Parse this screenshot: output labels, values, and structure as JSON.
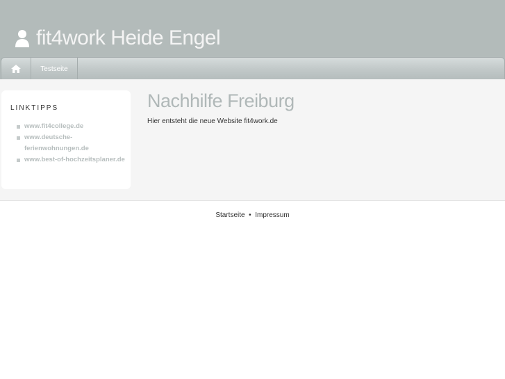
{
  "header": {
    "title": "fit4work Heide Engel"
  },
  "nav": {
    "items": [
      {
        "label": "Testseite"
      }
    ]
  },
  "sidebar": {
    "heading": "LINKTIPPS",
    "links": [
      "www.fit4college.de",
      "www.deutsche-ferienwohnungen.de",
      "www.best-of-hochzeitsplaner.de"
    ]
  },
  "content": {
    "title": "Nachhilfe Freiburg",
    "text": "Hier entsteht die neue Website fit4work.de"
  },
  "footer": {
    "links": [
      "Startseite",
      "Impressum"
    ],
    "separator": "•"
  }
}
